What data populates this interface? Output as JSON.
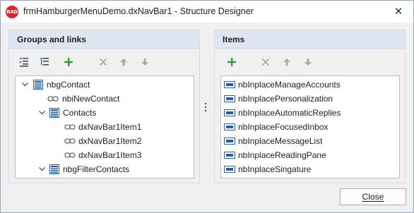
{
  "window": {
    "title": "frmHamburgerMenuDemo.dxNavBar1 - Structure Designer",
    "app_icon_text": "RAD",
    "close_glyph": "✕"
  },
  "left_panel": {
    "header": "Groups and links",
    "toolbar": [
      "collapse-all-icon",
      "expand-all-icon",
      "add-icon",
      "delete-icon",
      "move-up-icon",
      "move-down-icon"
    ],
    "tree": [
      {
        "label": "nbgContact",
        "type": "group",
        "level": 0,
        "expanded": true
      },
      {
        "label": "nbiNewContact",
        "type": "link",
        "level": 1
      },
      {
        "label": "Contacts",
        "type": "group",
        "level": 1,
        "expanded": true
      },
      {
        "label": "dxNavBar1Item1",
        "type": "link",
        "level": 2
      },
      {
        "label": "dxNavBar1Item2",
        "type": "link",
        "level": 2
      },
      {
        "label": "dxNavBar1Item3",
        "type": "link",
        "level": 2
      },
      {
        "label": "nbgFilterContacts",
        "type": "group",
        "level": 1,
        "expanded": true
      }
    ]
  },
  "right_panel": {
    "header": "Items",
    "toolbar": [
      "add-icon",
      "delete-icon",
      "move-up-icon",
      "move-down-icon"
    ],
    "items": [
      "nbInplaceManageAccounts",
      "nbInplacePersonalization",
      "nbInplaceAutomaticReplies",
      "nbInplaceFocusedInbox",
      "nbInplaceMessageList",
      "nbInplaceReadingPane",
      "nbInplaceSingature"
    ]
  },
  "footer": {
    "close_label": "Close"
  },
  "colors": {
    "accent_green": "#2e9b3e",
    "disabled_gray": "#a9a9a9",
    "item_blue": "#1f5fb0",
    "panel_header": "#dde6f1"
  }
}
